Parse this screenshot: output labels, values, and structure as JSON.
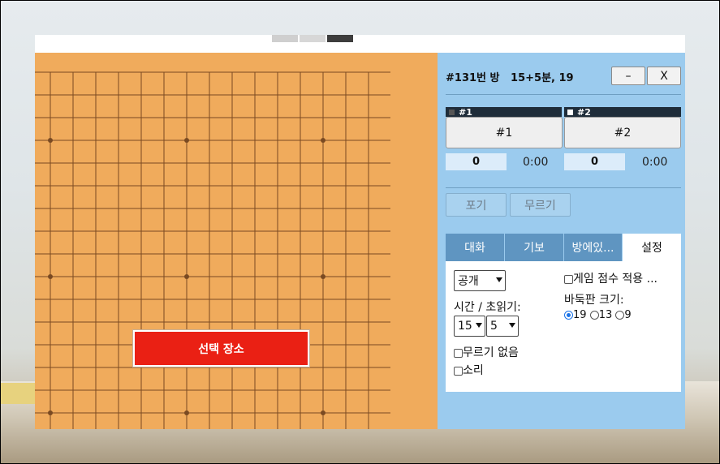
{
  "room": {
    "title": "#131번 방   15+5분, 19",
    "minimize_label": "–",
    "close_label": "X"
  },
  "players": [
    {
      "tag": "#1",
      "name": "#1",
      "score": "0",
      "time": "0:00",
      "stone": "black"
    },
    {
      "tag": "#2",
      "name": "#2",
      "score": "0",
      "time": "0:00",
      "stone": "white"
    }
  ],
  "actions": {
    "resign_label": "포기",
    "undo_label": "무르기"
  },
  "board": {
    "size": 19,
    "place_button_label": "선택 장소"
  },
  "tabs": [
    {
      "label": "대화",
      "active": false
    },
    {
      "label": "기보",
      "active": false
    },
    {
      "label": "방에있...",
      "active": false
    },
    {
      "label": "설정",
      "active": true
    }
  ],
  "settings": {
    "visibility_value": "공개",
    "time_label": "시간 / 초읽기:",
    "time_value": "15",
    "byoyomi_value": "5",
    "no_undo_label": "무르기 없음",
    "sound_label": "소리",
    "apply_score_label": "게임 점수 적용 ...",
    "board_size_label": "바둑판 크기:",
    "board_sizes": [
      {
        "label": "19",
        "selected": true
      },
      {
        "label": "13",
        "selected": false
      },
      {
        "label": "9",
        "selected": false
      }
    ]
  },
  "colors": {
    "board": "#f0ab5c",
    "grid": "#7a4a22",
    "panel": "#9bcbee",
    "tab": "#5f95c1",
    "place_button": "#ea2014"
  }
}
